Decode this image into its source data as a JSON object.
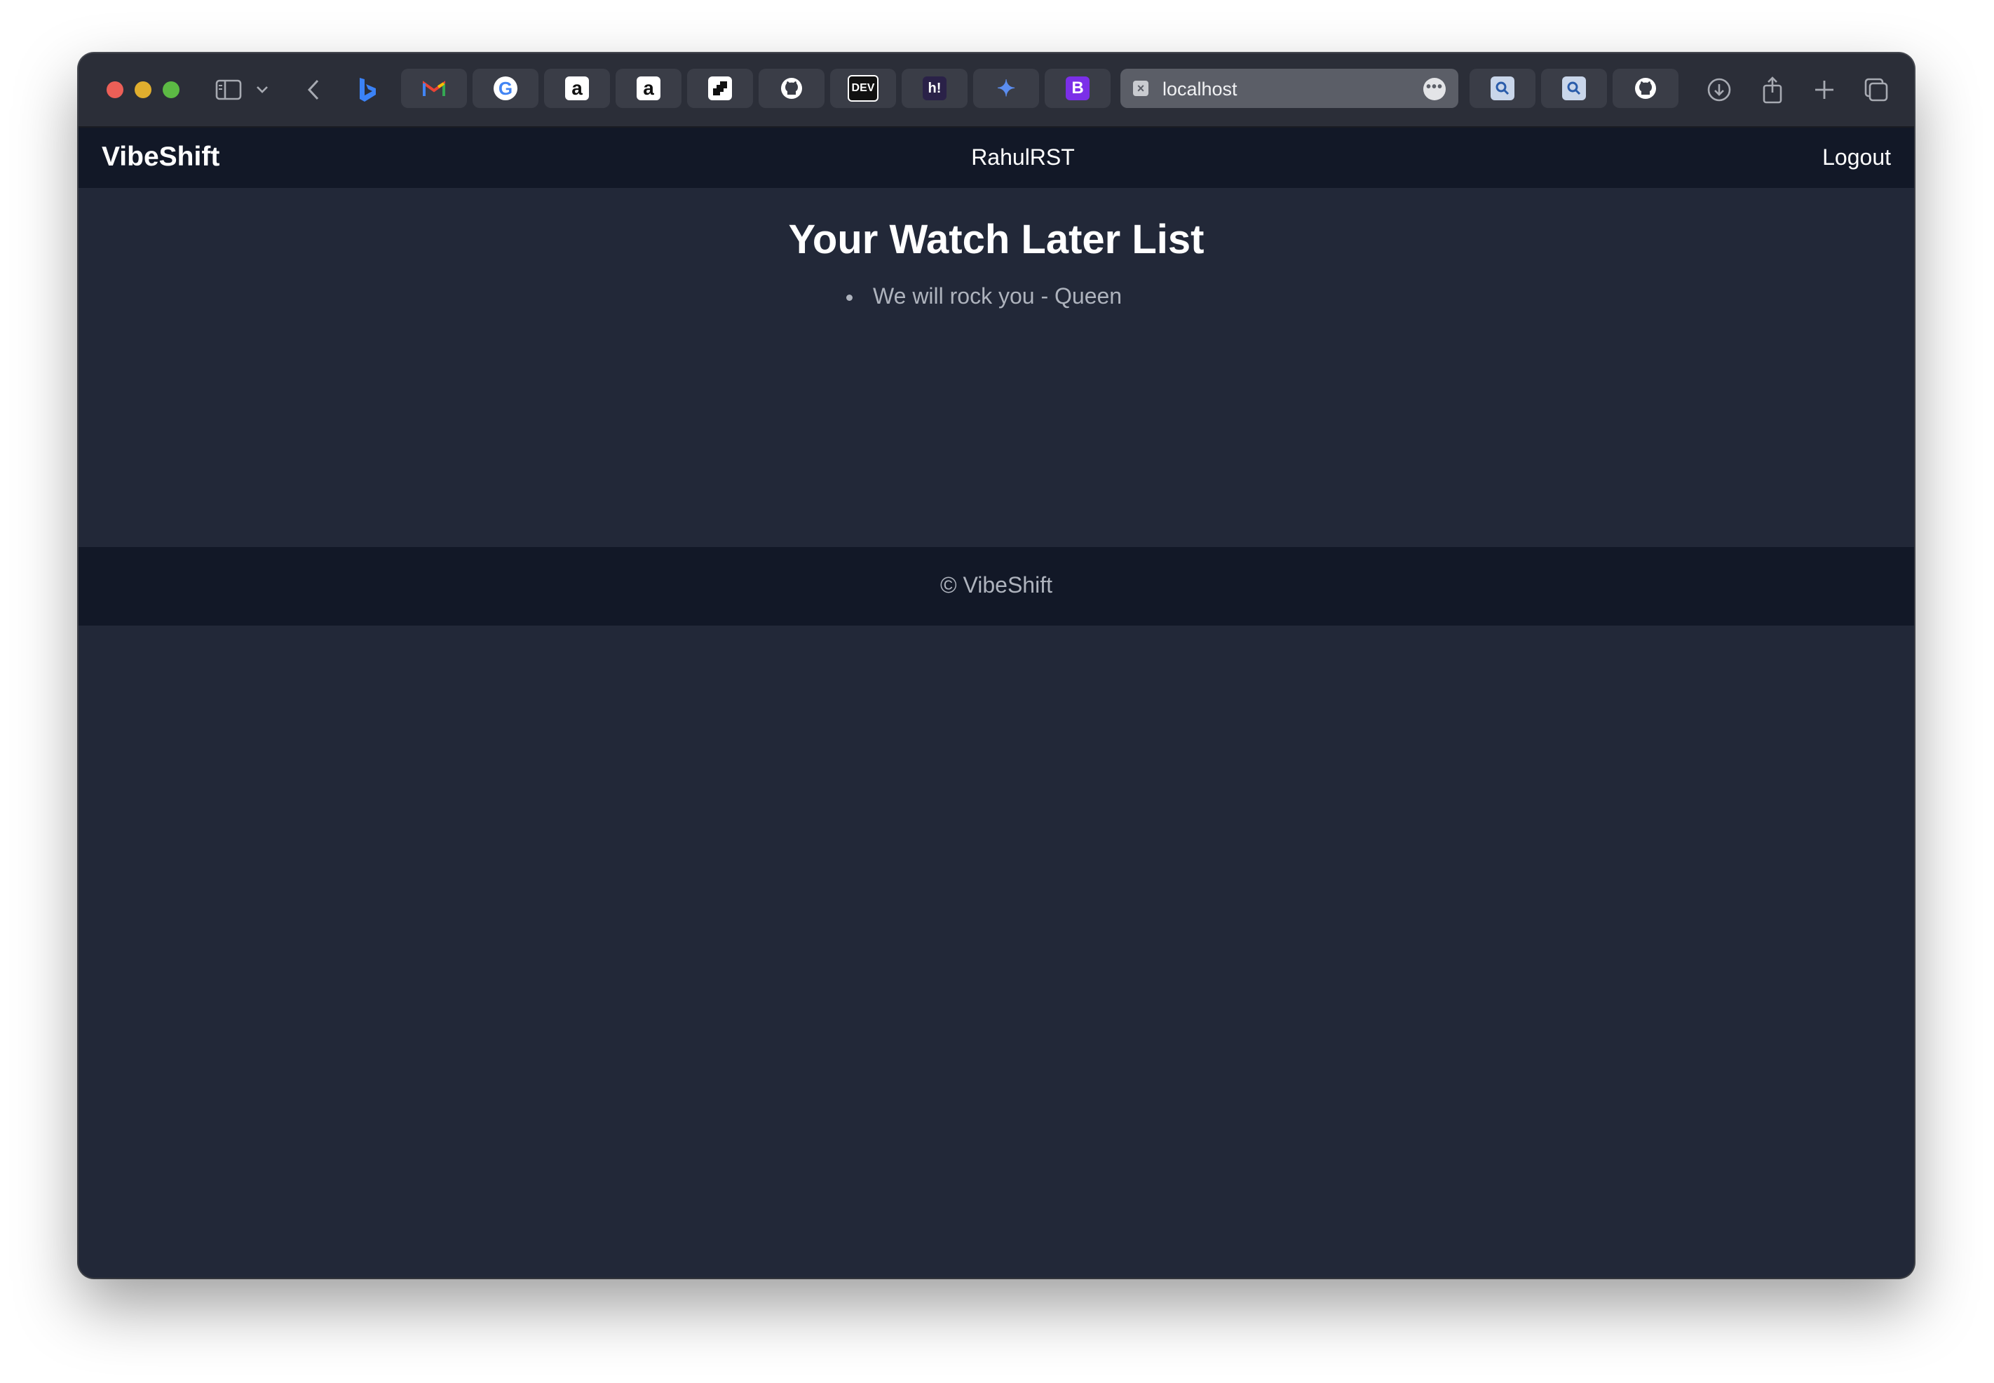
{
  "browser": {
    "address_url": "localhost",
    "more_glyph": "•••",
    "bookmarks": [
      {
        "icon": "bing-icon",
        "glyph": "b",
        "color": "#3b82f6"
      },
      {
        "icon": "gmail-icon",
        "glyph": "M",
        "color": "#ea4335"
      },
      {
        "icon": "google-icon",
        "glyph": "G",
        "color": "#4285f4"
      },
      {
        "icon": "amazon-icon",
        "glyph": "a",
        "color": "#111111"
      },
      {
        "icon": "amazon-icon",
        "glyph": "a",
        "color": "#111111"
      },
      {
        "icon": "medium-icon",
        "glyph": "◪",
        "color": "#111111"
      },
      {
        "icon": "github-icon",
        "glyph": "",
        "color": "#ffffff"
      },
      {
        "icon": "dev-icon",
        "glyph": "DEV",
        "color": "#ffffff"
      },
      {
        "icon": "hashnode-icon",
        "glyph": "h!",
        "color": "#ffffff"
      },
      {
        "icon": "gemini-icon",
        "glyph": "✦",
        "color": "#5b8def"
      },
      {
        "icon": "bootstrap-icon",
        "glyph": "B",
        "color": "#ffffff"
      }
    ]
  },
  "navbar": {
    "brand": "VibeShift",
    "username": "RahulRST",
    "logout_label": "Logout"
  },
  "main": {
    "title": "Your Watch Later List",
    "items": [
      "We will rock you - Queen"
    ]
  },
  "footer": {
    "text": "© VibeShift"
  },
  "colors": {
    "page_bg": "#222838",
    "navbar_bg": "#121827",
    "text_primary": "#ffffff",
    "text_muted": "#aeb3bd"
  }
}
